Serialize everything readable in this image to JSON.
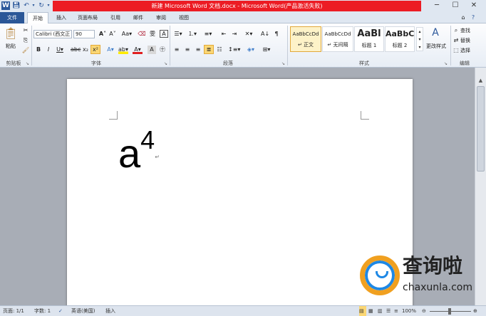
{
  "window": {
    "title": "新建 Microsoft Word 文档.docx - Microsoft Word(产品激活失败)"
  },
  "tabs": [
    "文件",
    "开始",
    "插入",
    "页面布局",
    "引用",
    "邮件",
    "审阅",
    "视图"
  ],
  "ribbon": {
    "clipboard": {
      "paste": "粘贴",
      "label": "剪贴板"
    },
    "font": {
      "name": "Calibri (西文正",
      "size": "90",
      "label": "字体"
    },
    "paragraph": {
      "label": "段落"
    },
    "styles": {
      "items": [
        {
          "preview": "AaBbCcDd",
          "name": "↵ 正文"
        },
        {
          "preview": "AaBbCcDd",
          "name": "↵ 无间隔"
        },
        {
          "preview": "AaBl",
          "name": "标题 1"
        },
        {
          "preview": "AaBbC",
          "name": "标题 2"
        }
      ],
      "change": "更改样式",
      "label": "样式"
    },
    "editing": {
      "find": "查找",
      "replace": "替换",
      "select": "选择",
      "label": "编辑"
    }
  },
  "document": {
    "base": "a",
    "superscript": "4"
  },
  "status": {
    "page": "页面: 1/1",
    "words": "字数: 1",
    "language": "英语(美国)",
    "mode": "插入",
    "zoom": "100%"
  },
  "watermark": {
    "cn": "查询啦",
    "en": "chaxunla.com"
  },
  "colors": {
    "accent": "#2b5797",
    "title_red": "#ec1c24"
  }
}
